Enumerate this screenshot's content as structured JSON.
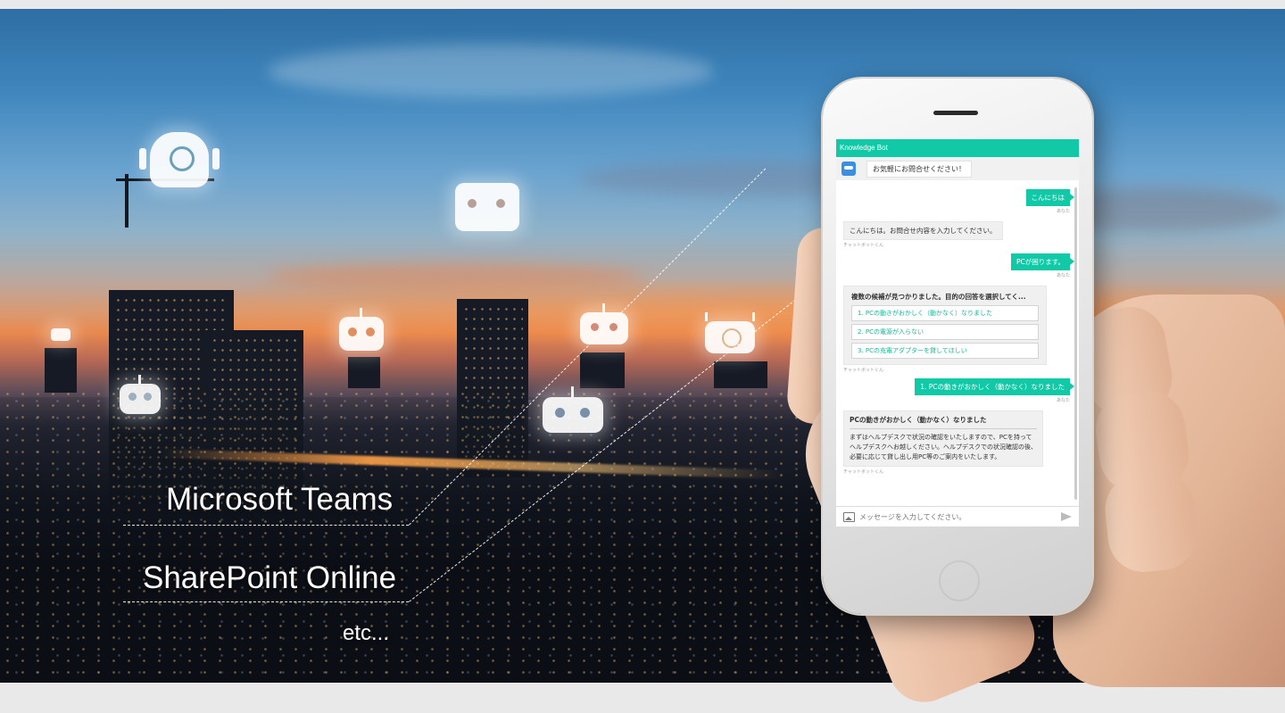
{
  "captions": {
    "teams": "Microsoft Teams",
    "sharepoint": "SharePoint Online",
    "etc": "etc..."
  },
  "chat": {
    "app_title": "Knowledge Bot",
    "greeting": "お気軽にお問合せください！",
    "messages": {
      "user1": "こんにちは",
      "user_label": "あなた",
      "bot1": "こんにちは。お問合せ内容を入力してください。",
      "bot_label": "チャットボットくん",
      "user2": "PCが困ります。",
      "candidates_title": "複数の候補が見つかりました。目的の回答を選択してく...",
      "options": [
        "1. PCの動きがおかしく（動かなく）なりました",
        "2. PCの電源が入らない",
        "3. PCの充電アダプターを貸してほしい"
      ],
      "user3": "1. PCの動きがおかしく（動かなく）なりました",
      "answer_title": "PCの動きがおかしく（動かなく）なりました",
      "answer_body": "まずはヘルプデスクで状況の確認をいたしますので、PCを持ってヘルプデスクへお越しください。ヘルプデスクでの状況確認の後、必要に応じて貸し出し用PC等のご案内をいたします。"
    },
    "input_placeholder": "メッセージを入力してください。"
  },
  "colors": {
    "accent": "#12c9a7",
    "sky_top": "#2e6ea3",
    "sunset": "#e9894f"
  },
  "icons": [
    "robot-icon",
    "image-icon",
    "send-icon",
    "bot-avatar-icon"
  ]
}
